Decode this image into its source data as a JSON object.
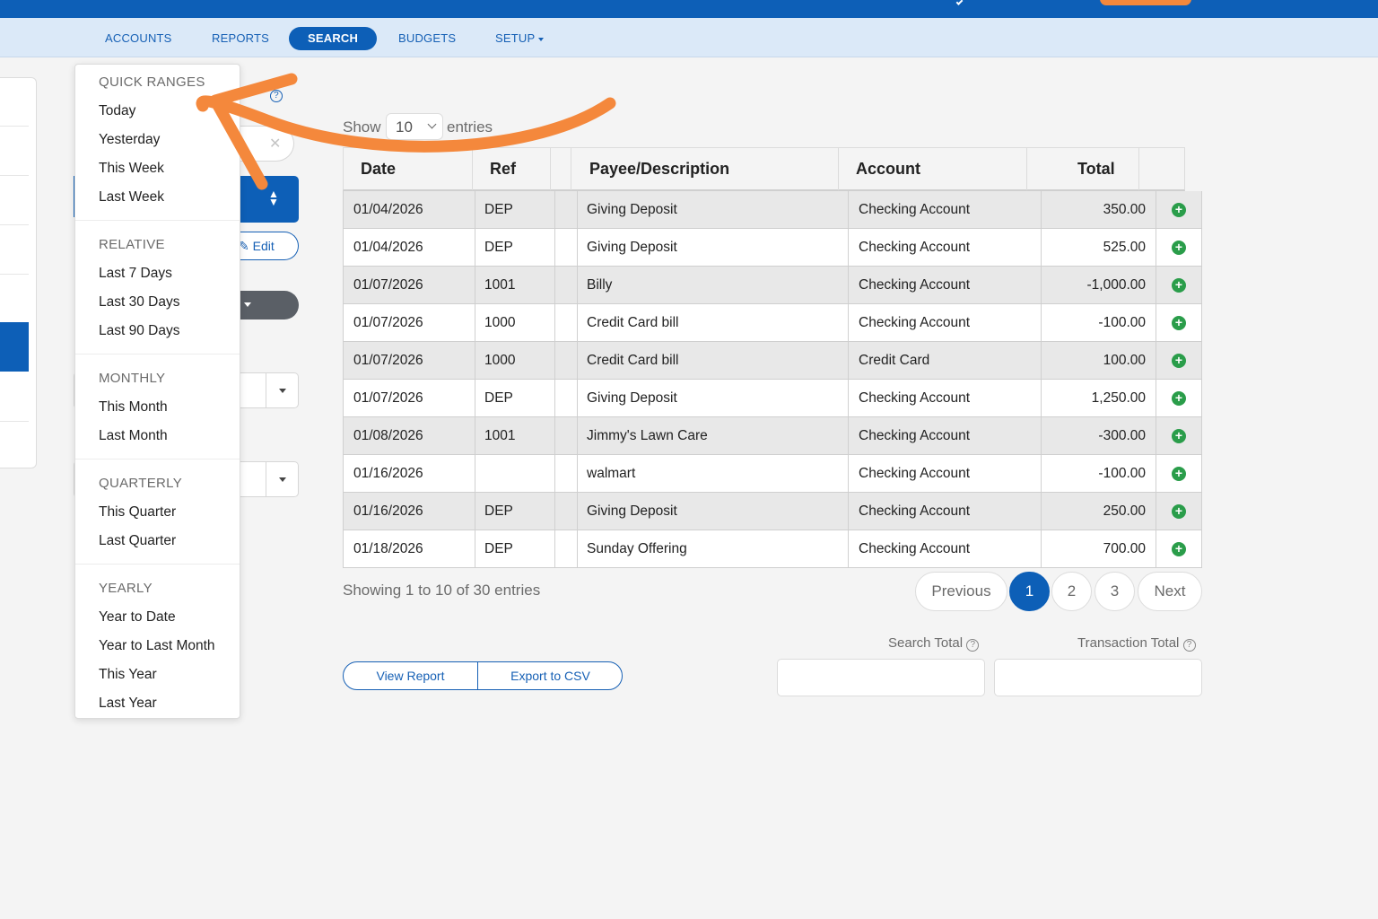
{
  "nav": {
    "items": [
      {
        "label": "ACCOUNTS"
      },
      {
        "label": "REPORTS"
      },
      {
        "label": "SEARCH"
      },
      {
        "label": "BUDGETS"
      },
      {
        "label": "SETUP"
      }
    ],
    "active": "SEARCH"
  },
  "form": {
    "edit_label": "Edit",
    "help_glyph": "?"
  },
  "dropdown": {
    "sections": [
      {
        "header": "QUICK RANGES",
        "items": [
          "Today",
          "Yesterday",
          "This Week",
          "Last Week"
        ]
      },
      {
        "header": "RELATIVE",
        "items": [
          "Last 7 Days",
          "Last 30 Days",
          "Last 90 Days"
        ]
      },
      {
        "header": "MONTHLY",
        "items": [
          "This Month",
          "Last Month"
        ]
      },
      {
        "header": "QUARTERLY",
        "items": [
          "This Quarter",
          "Last Quarter"
        ]
      },
      {
        "header": "YEARLY",
        "items": [
          "Year to Date",
          "Year to Last Month",
          "This Year",
          "Last Year"
        ]
      }
    ]
  },
  "table": {
    "show_label": "Show",
    "entries_label": "entries",
    "page_size": "10",
    "columns": [
      "Date",
      "Ref",
      "",
      "Payee/Description",
      "Account",
      "Total"
    ],
    "rows": [
      {
        "date": "01/04/2026",
        "ref": "DEP",
        "payee": "Giving Deposit",
        "account": "Checking Account",
        "total": "350.00"
      },
      {
        "date": "01/04/2026",
        "ref": "DEP",
        "payee": "Giving Deposit",
        "account": "Checking Account",
        "total": "525.00"
      },
      {
        "date": "01/07/2026",
        "ref": "1001",
        "payee": "Billy",
        "account": "Checking Account",
        "total": "-1,000.00"
      },
      {
        "date": "01/07/2026",
        "ref": "1000",
        "payee": "Credit Card bill",
        "account": "Checking Account",
        "total": "-100.00"
      },
      {
        "date": "01/07/2026",
        "ref": "1000",
        "payee": "Credit Card bill",
        "account": "Credit Card",
        "total": "100.00"
      },
      {
        "date": "01/07/2026",
        "ref": "DEP",
        "payee": "Giving Deposit",
        "account": "Checking Account",
        "total": "1,250.00"
      },
      {
        "date": "01/08/2026",
        "ref": "1001",
        "payee": "Jimmy's Lawn Care",
        "account": "Checking Account",
        "total": "-300.00"
      },
      {
        "date": "01/16/2026",
        "ref": "",
        "payee": "walmart",
        "account": "Checking Account",
        "total": "-100.00"
      },
      {
        "date": "01/16/2026",
        "ref": "DEP",
        "payee": "Giving Deposit",
        "account": "Checking Account",
        "total": "250.00"
      },
      {
        "date": "01/18/2026",
        "ref": "DEP",
        "payee": "Sunday Offering",
        "account": "Checking Account",
        "total": "700.00"
      }
    ],
    "showing": "Showing 1 to 10 of 30 entries"
  },
  "pagination": {
    "previous": "Previous",
    "pages": [
      "1",
      "2",
      "3"
    ],
    "current": "1",
    "next": "Next"
  },
  "actions": {
    "view_report": "View Report",
    "export_csv": "Export to CSV"
  },
  "totals": {
    "search_total_label": "Search Total",
    "transaction_total_label": "Transaction Total",
    "search_total_value": "",
    "transaction_total_value": ""
  },
  "colors": {
    "brand_blue": "#0d5fb7",
    "nav_bg": "#dbe9f8",
    "accent_orange": "#f4883c",
    "add_green": "#2a9d4a"
  },
  "icons": [
    "sort-icon",
    "edit-icon",
    "help-icon",
    "plus-circle-icon",
    "chevron-down-icon",
    "clear-icon"
  ]
}
